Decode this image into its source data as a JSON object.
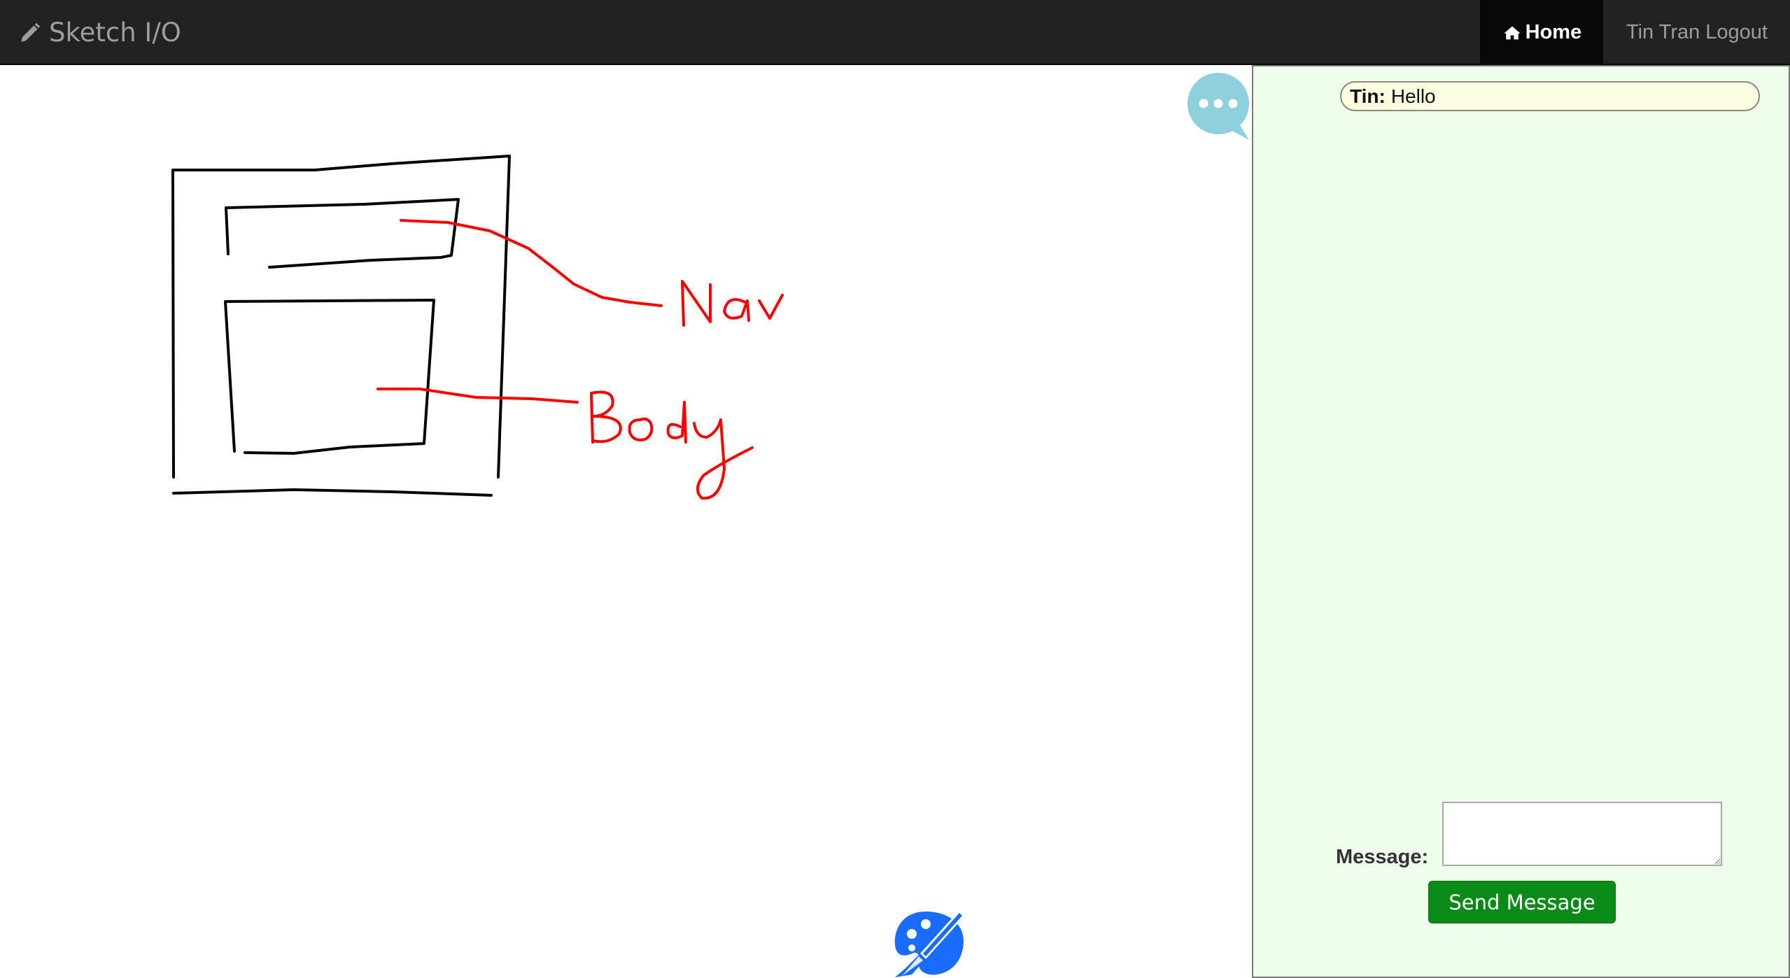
{
  "navbar": {
    "brand_icon": "pencil-icon",
    "brand_label": "Sketch I/O",
    "home_icon": "home-icon",
    "home_label": "Home",
    "user_logout_label": "Tin Tran Logout",
    "background": "#222222",
    "active_background": "#080808"
  },
  "canvas": {
    "strokes_colors": {
      "black": "#000000",
      "red": "#ff0000"
    },
    "chat_toggle_icon": "speech-bubble-ellipsis-icon",
    "palette_icon": "palette-brush-icon",
    "accent": "#1a6cff"
  },
  "chat": {
    "background": "#eefdec",
    "messages": [
      {
        "sender": "Tin:",
        "text": "Hello"
      }
    ],
    "message_label": "Message:",
    "message_input_value": "",
    "send_button_label": "Send Message",
    "send_button_color": "#0a8a17"
  }
}
